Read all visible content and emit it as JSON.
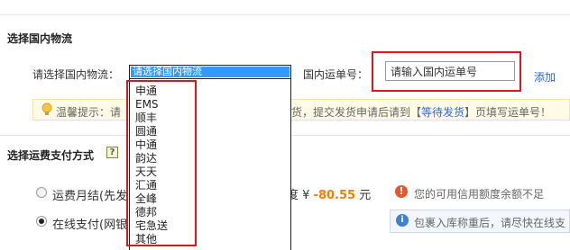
{
  "section1": {
    "title": "选择国内物流"
  },
  "logistics": {
    "label": "请选择国内物流：",
    "selected": "请选择国内物流",
    "options": [
      "申通",
      "EMS",
      "顺丰",
      "圆通",
      "中通",
      "韵达",
      "天天",
      "汇通",
      "全峰",
      "德邦",
      "宅急送",
      "其他"
    ]
  },
  "tracking": {
    "label": "国内运单号：",
    "placeholder": "请输入国内运单号",
    "add_label": "添加"
  },
  "tip": {
    "left_text": "温馨提示：请",
    "right_prefix": "货，提交发货申请后请到【",
    "link": "等待发货",
    "right_suffix": "】页填写运单号！"
  },
  "section2": {
    "title": "选择运费支付方式",
    "help": "?"
  },
  "payment": {
    "monthly_label": "运费月结(先发",
    "online_label": "在线支付(网银",
    "amount_prefix": "度 ¥ ",
    "amount": "-80.55",
    "amount_unit": " 元",
    "warning": "您的可用信用额度余额不足",
    "info": "包裹入库称重后，请尽快在线支"
  },
  "colors": {
    "accent_red": "#e0161d",
    "link_blue": "#3366cc",
    "amount_orange": "#f08000"
  }
}
